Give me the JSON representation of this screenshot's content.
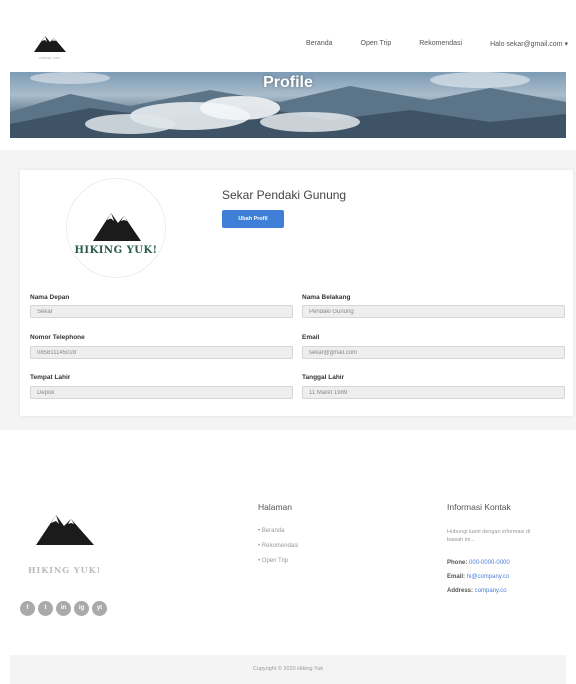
{
  "navbar": {
    "logo_text": "HIKING YUK!",
    "links": [
      "Beranda",
      "Open Trip",
      "Rekomendasi"
    ],
    "user_email": "Halo sekar@gmail.com"
  },
  "hero": {
    "title": "Profile"
  },
  "profile": {
    "avatar_text": "HIKING YUK!",
    "name": "Sekar Pendaki Gunung",
    "edit_button": "Ubah Profil",
    "fields": {
      "first_name": {
        "label": "Nama Depan",
        "value": "Sekar"
      },
      "last_name": {
        "label": "Nama Belakang",
        "value": "Pendaki Gunung"
      },
      "phone": {
        "label": "Nomor Telephone",
        "value": "085811145028"
      },
      "email": {
        "label": "Email",
        "value": "sekar@gmail.com"
      },
      "birth_place": {
        "label": "Tempat Lahir",
        "value": "Depok"
      },
      "birth_date": {
        "label": "Tanggal Lahir",
        "value": "11 Maret 1989"
      }
    }
  },
  "footer": {
    "brand": "HIKING YUK!",
    "socials": [
      "f",
      "t",
      "in",
      "ig",
      "yt"
    ],
    "pages": {
      "title": "Halaman",
      "items": [
        "Beranda",
        "Rekomendasi",
        "Open Trip"
      ]
    },
    "contact": {
      "title": "Informasi Kontak",
      "description": "Hubungi kami dengan informasi di bawah ini...",
      "phone_label": "Phone:",
      "phone": "000-0000-0000",
      "email_label": "Email:",
      "email": "hi@company.co",
      "address_label": "Address:",
      "address": "company.co"
    },
    "copyright": "Copyright © 2020 Hiking Yuk"
  },
  "colors": {
    "accent": "#3f7fd8",
    "link": "#4a7fd8",
    "brand_green": "#2a5a4f"
  }
}
